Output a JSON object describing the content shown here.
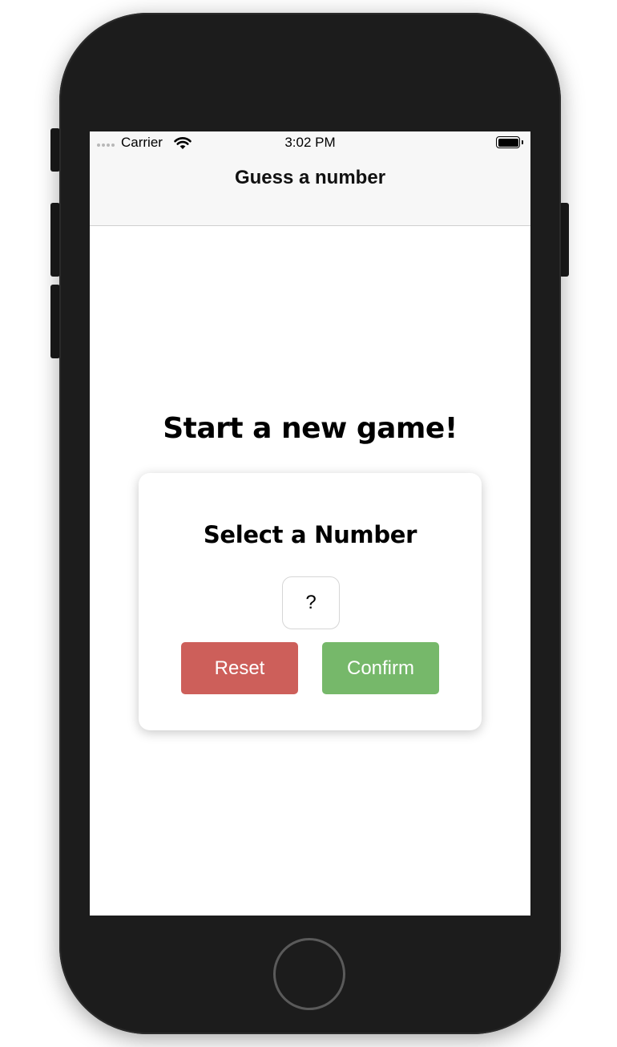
{
  "status_bar": {
    "carrier": "Carrier",
    "time": "3:02 PM"
  },
  "header": {
    "title": "Guess a number"
  },
  "main": {
    "headline": "Start a new game!",
    "card": {
      "title": "Select a Number",
      "number_placeholder": "?",
      "reset_label": "Reset",
      "confirm_label": "Confirm"
    }
  },
  "colors": {
    "reset": "#cd5f5a",
    "confirm": "#76b86a",
    "header_bg": "#f7f7f7"
  }
}
